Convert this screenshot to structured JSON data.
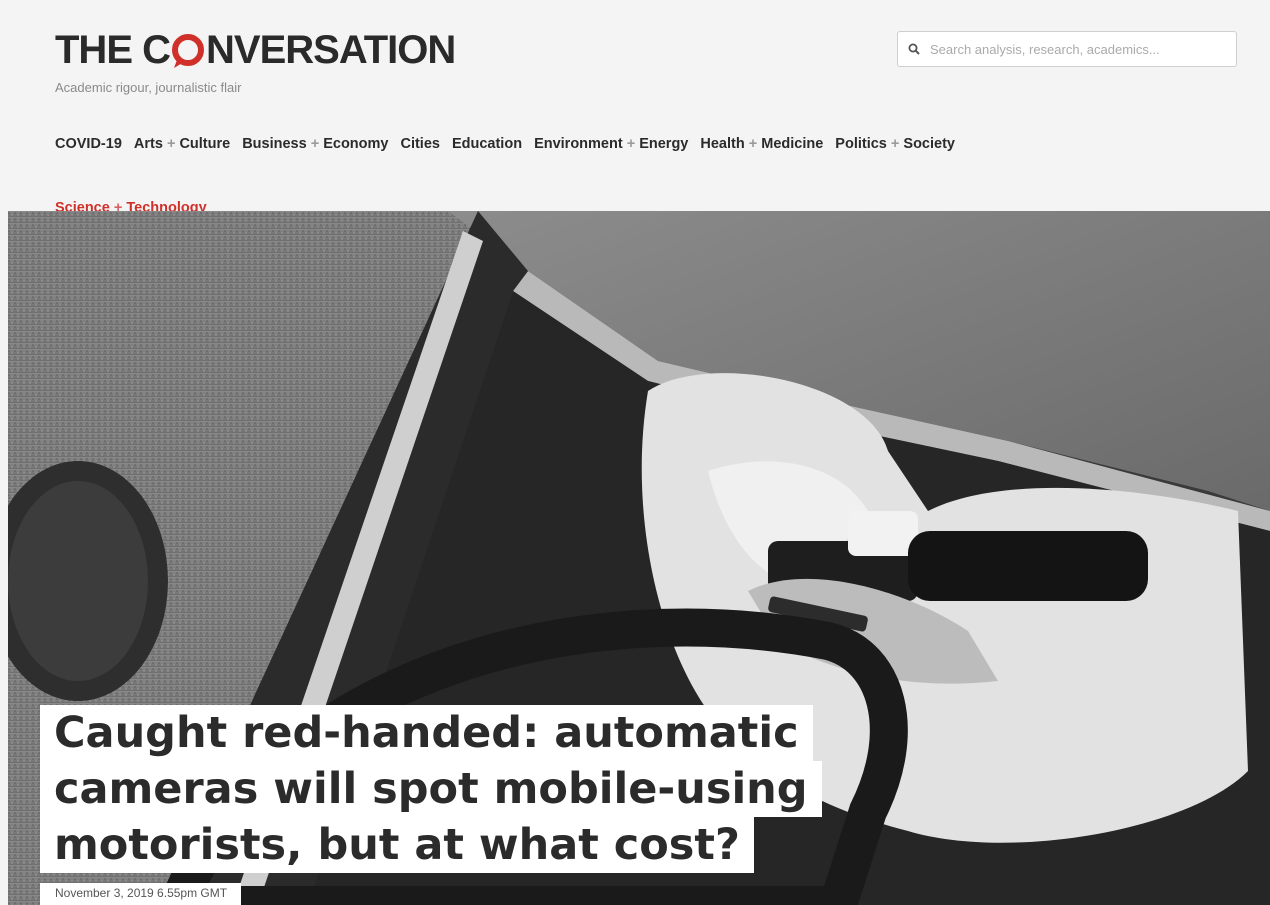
{
  "brand": {
    "logo_pre": "THE C",
    "logo_post": "NVERSATION",
    "tagline": "Academic rigour, journalistic flair",
    "accent_color": "#d0302a"
  },
  "search": {
    "placeholder": "Search analysis, research, academics...",
    "icon": "search-icon"
  },
  "nav": {
    "items": [
      {
        "a": "COVID-19",
        "b": ""
      },
      {
        "a": "Arts",
        "b": "Culture"
      },
      {
        "a": "Business",
        "b": "Economy"
      },
      {
        "a": "Cities",
        "b": ""
      },
      {
        "a": "Education",
        "b": ""
      },
      {
        "a": "Environment",
        "b": "Energy"
      },
      {
        "a": "Health",
        "b": "Medicine"
      },
      {
        "a": "Politics",
        "b": "Society"
      },
      {
        "a": "Science",
        "b": "Technology"
      }
    ],
    "plus": "+",
    "active_index": 8
  },
  "article": {
    "headline_lines": [
      "Caught red-handed: automatic",
      "cameras will spot mobile-using",
      "motorists, but at what cost?"
    ],
    "date": "November 3, 2019 6.55pm GMT"
  }
}
